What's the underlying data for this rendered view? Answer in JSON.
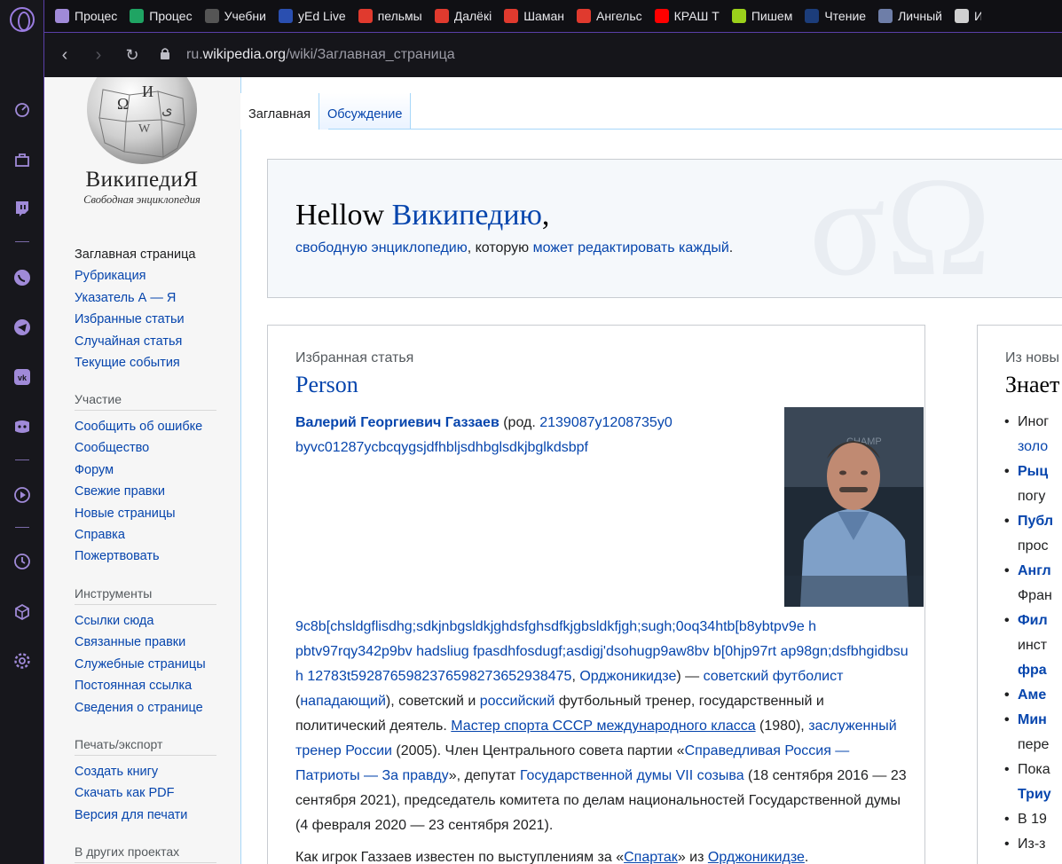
{
  "bookmarks": [
    {
      "label": "Процес",
      "icon": "gamepad-icon",
      "color": "#a08ad8"
    },
    {
      "label": "Процес",
      "icon": "google-drive-icon",
      "color": "#1fa463"
    },
    {
      "label": "Учебни",
      "icon": "classroom-icon",
      "color": "#555"
    },
    {
      "label": "yEd Live",
      "icon": "yed-icon",
      "color": "#2a4fb0"
    },
    {
      "label": "пельмы",
      "icon": "d-icon",
      "color": "#e03a2e"
    },
    {
      "label": "Далёкі",
      "icon": "a-icon",
      "color": "#e03a2e"
    },
    {
      "label": "Шаман",
      "icon": "a-icon",
      "color": "#e03a2e"
    },
    {
      "label": "Ангельс",
      "icon": "a-icon",
      "color": "#e03a2e"
    },
    {
      "label": "КРАШ Т",
      "icon": "youtube-icon",
      "color": "#ff0000"
    },
    {
      "label": "Пишем",
      "icon": "circle-icon",
      "color": "#9bd11b"
    },
    {
      "label": "Чтение",
      "icon": "r-icon",
      "color": "#1c3d7a"
    },
    {
      "label": "Личный",
      "icon": "id-icon",
      "color": "#6e7ea8"
    },
    {
      "label": "И",
      "icon": "book-icon",
      "color": "#d0d0d0"
    }
  ],
  "address": {
    "url_prefix": "ru.",
    "url_host": "wikipedia.org",
    "url_path": "/wiki/Заглавная_страница"
  },
  "logo": {
    "title": "ВикипедиЯ",
    "tagline": "Свободная энциклопедия"
  },
  "sidebar": {
    "main": [
      "Заглавная страница",
      "Рубрикация",
      "Указатель А — Я",
      "Избранные статьи",
      "Случайная статья",
      "Текущие события"
    ],
    "participation_heading": "Участие",
    "participation": [
      "Сообщить об ошибке",
      "Сообщество",
      "Форум",
      "Свежие правки",
      "Новые страницы",
      "Справка",
      "Пожертвовать"
    ],
    "tools_heading": "Инструменты",
    "tools": [
      "Ссылки сюда",
      "Связанные правки",
      "Служебные страницы",
      "Постоянная ссылка",
      "Сведения о странице"
    ],
    "print_heading": "Печать/экспорт",
    "print": [
      "Создать книгу",
      "Скачать как PDF",
      "Версия для печати"
    ],
    "other_heading": "В других проектах"
  },
  "tabs": [
    "Заглавная",
    "Обсуждение"
  ],
  "welcome": {
    "hello": "Hellow ",
    "link": "Википедию",
    "comma": ",",
    "sub_link1": "свободную энциклопедию",
    "sub_mid": ", которую ",
    "sub_link2": "может редактировать каждый",
    "sub_end": "."
  },
  "featured": {
    "caption": "Избранная статья",
    "title": "Person",
    "name": "Валерий Георгиевич Газзаев",
    "rod": " (род. ",
    "top_link": "2139087y1208735y0 byvc01287ycbcqygsjdfhbljsdhbglsdkjbglkdsbpf",
    "body_link1": "9c8b[chsldgflisdhg;sdkjnbgsldkjghdsfghsdfkjgbsldkfjgh;sugh;0oq34htb[b8ybtpv9e h pbtv97rqy342p9bv hadsliug fpasdhfosdugf;asdigj'dsohugp9aw8bv b[0hjp97rt ap98gn;dsfbhgidbsu h 12783t5928765982376598273652938475",
    "sep1": ", ",
    "body_link2": "Орджоникидзе",
    "t1": ") — ",
    "body_link3": "советский футболист",
    "t2": " (",
    "body_link4": "нападающий",
    "t3": "), советский и ",
    "body_link5": "российский",
    "t4": " футбольный тренер, государственный и политический деятель. ",
    "body_link6": "Мастер спорта СССР международного класса",
    "t5": " (1980), ",
    "body_link7": "заслуженный тренер России",
    "t6": " (2005). Член Центрального совета партии «",
    "body_link8": "Справедливая Россия — Патриоты — За правду",
    "t7": "», депутат ",
    "body_link9": "Государственной думы VII созыва",
    "t8": " (18 сентября 2016 — 23 сентября 2021), председатель комитета по делам национальностей Государственной думы (4 февраля 2020 — 23 сентября 2021).",
    "p2_a": "Как игрок Газзаев известен по выступлениям за «",
    "p2_link1": "Спартак",
    "p2_b": "» из ",
    "p2_link2": "Орджоникидзе",
    "p2_c": "."
  },
  "news": {
    "caption": "Из новы",
    "title": "Знает",
    "items": [
      {
        "text": "Иног",
        "bullet": true,
        "link": false,
        "bold": false
      },
      {
        "text": "золо",
        "bullet": false,
        "link": true,
        "bold": false
      },
      {
        "text": "Рыц",
        "bullet": true,
        "link": true,
        "bold": true
      },
      {
        "text": "погу",
        "bullet": false,
        "link": false,
        "bold": false
      },
      {
        "text": "Публ",
        "bullet": true,
        "link": true,
        "bold": true
      },
      {
        "text": "прос",
        "bullet": false,
        "link": false,
        "bold": false
      },
      {
        "text": "Англ",
        "bullet": true,
        "link": true,
        "bold": true
      },
      {
        "text": "Фран",
        "bullet": false,
        "link": false,
        "bold": false
      },
      {
        "text": "Фил",
        "bullet": true,
        "link": true,
        "bold": true
      },
      {
        "text": "инст",
        "bullet": false,
        "link": false,
        "bold": false
      },
      {
        "text": "фра",
        "bullet": false,
        "link": true,
        "bold": true
      },
      {
        "text": "Аме",
        "bullet": true,
        "link": true,
        "bold": true
      },
      {
        "text": "Мин",
        "bullet": true,
        "link": true,
        "bold": true
      },
      {
        "text": "пере",
        "bullet": false,
        "link": false,
        "bold": false
      },
      {
        "text": "Пока",
        "bullet": true,
        "link": false,
        "bold": false
      },
      {
        "text": "Триу",
        "bullet": false,
        "link": true,
        "bold": true
      },
      {
        "text": "В 19",
        "bullet": true,
        "link": false,
        "bold": false
      },
      {
        "text": "Из-з",
        "bullet": true,
        "link": false,
        "bold": false
      }
    ]
  }
}
